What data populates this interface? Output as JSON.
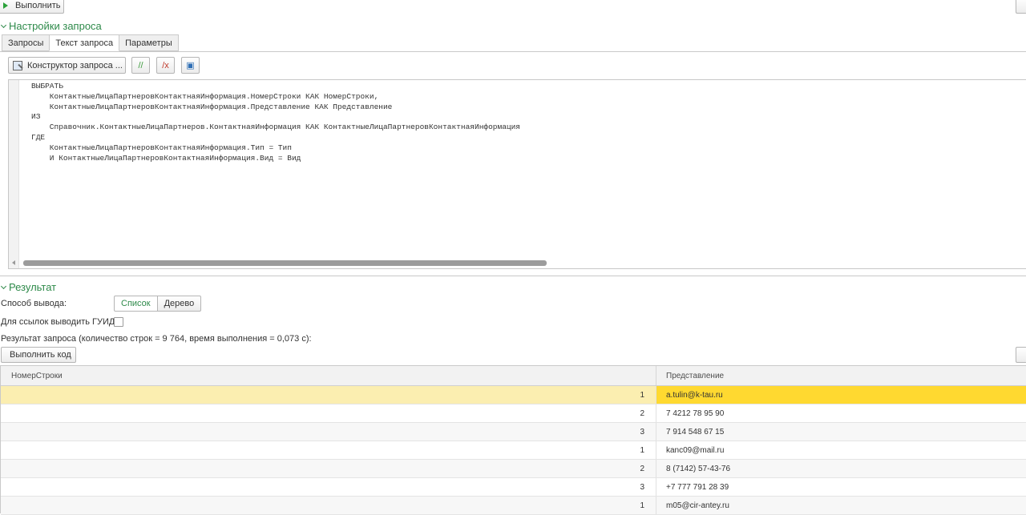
{
  "toolbar": {
    "run_label": "Выполнить"
  },
  "query_settings": {
    "title": "Настройки запроса",
    "tabs": [
      {
        "label": "Запросы",
        "active": false
      },
      {
        "label": "Текст запроса",
        "active": true
      },
      {
        "label": "Параметры",
        "active": false
      }
    ],
    "constructor_label": "Конструктор запроса ...",
    "tool_icons": [
      {
        "name": "comment-icon",
        "glyph": "//"
      },
      {
        "name": "uncomment-icon",
        "glyph": "/x"
      },
      {
        "name": "format-icon",
        "glyph": "▣"
      }
    ],
    "query_text": "ВЫБРАТЬ\n    КонтактныеЛицаПартнеровКонтактнаяИнформация.НомерСтроки КАК НомерСтроки,\n    КонтактныеЛицаПартнеровКонтактнаяИнформация.Представление КАК Представление\nИЗ\n    Справочник.КонтактныеЛицаПартнеров.КонтактнаяИнформация КАК КонтактныеЛицаПартнеровКонтактнаяИнформация\nГДЕ\n    КонтактныеЛицаПартнеровКонтактнаяИнформация.Тип = Тип\n    И КонтактныеЛицаПартнеровКонтактнаяИнформация.Вид = Вид"
  },
  "result": {
    "title": "Результат",
    "output_mode_label": "Способ вывода:",
    "output_modes": [
      {
        "label": "Список",
        "selected": true
      },
      {
        "label": "Дерево",
        "selected": false
      }
    ],
    "guid_label": "Для ссылок выводить ГУИД:",
    "guid_checked": false,
    "summary": "Результат запроса (количество строк = 9 764, время выполнения = 0,073 с):",
    "exec_code_label": "Выполнить код",
    "columns": [
      "НомерСтроки",
      "Представление"
    ],
    "rows": [
      {
        "num": "1",
        "value": "a.tulin@k-tau.ru",
        "selected": true
      },
      {
        "num": "2",
        "value": "7 4212 78 95 90"
      },
      {
        "num": "3",
        "value": "7 914 548 67 15"
      },
      {
        "num": "1",
        "value": "kanc09@mail.ru"
      },
      {
        "num": "2",
        "value": "8 (7142) 57-43-76"
      },
      {
        "num": "3",
        "value": "+7 777 791 28 39"
      },
      {
        "num": "1",
        "value": "m05@cir-antey.ru"
      }
    ]
  },
  "colors": {
    "accent": "#2e8a4a",
    "selection_row": "#fbeeb0",
    "selection_cell": "#ffd930"
  }
}
